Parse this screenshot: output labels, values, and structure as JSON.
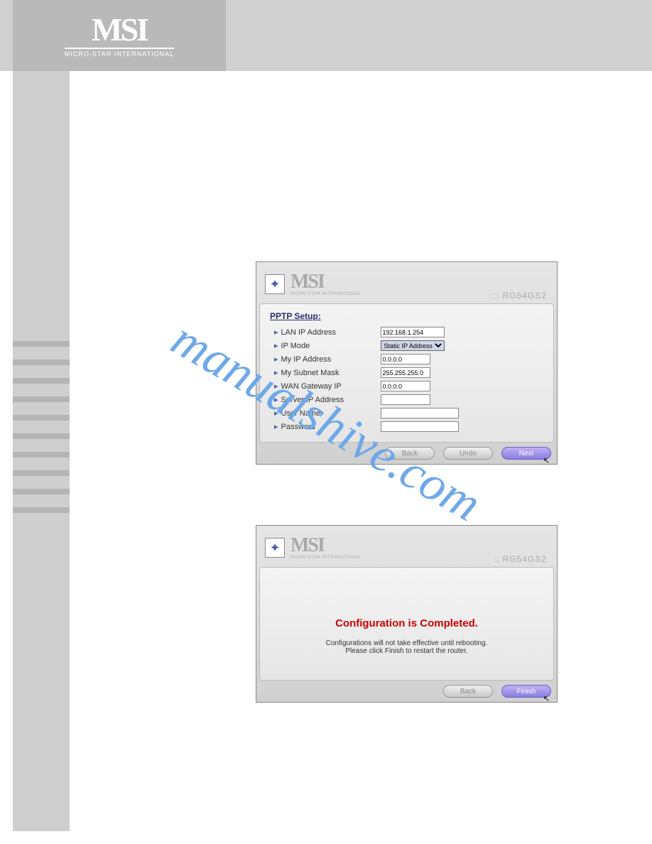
{
  "header": {
    "logo": "MSI",
    "tagline": "MICRO-STAR INTERNATIONAL"
  },
  "watermark": "manualshive.com",
  "panel1": {
    "logo": "MSI",
    "logo_sub": "MICRO-STAR INTERNATIONAL",
    "model": ":: RG54GS2",
    "section_title": "PPTP Setup:",
    "fields": {
      "lan_ip_label": "LAN IP Address",
      "lan_ip_value": "192.168.1.254",
      "ip_mode_label": "IP Mode",
      "ip_mode_value": "Static IP Address",
      "my_ip_label": "My IP Address",
      "my_ip_value": "0.0.0.0",
      "subnet_label": "My Subnet Mask",
      "subnet_value": "255.255.255.0",
      "wan_gw_label": "WAN Gateway IP",
      "wan_gw_value": "0.0.0.0",
      "server_ip_label": "Server IP Address",
      "server_ip_value": "",
      "username_label": "User Name",
      "username_value": "",
      "password_label": "Password",
      "password_value": ""
    },
    "buttons": {
      "back": "Back",
      "undo": "Undo",
      "next": "Next"
    }
  },
  "panel2": {
    "logo": "MSI",
    "logo_sub": "MICRO-STAR INTERNATIONAL",
    "model": ":: RG54GS2",
    "complete_title": "Configuration is Completed.",
    "complete_line1": "Configurations will not take effective until rebooting.",
    "complete_line2": "Please click Finish to restart the router.",
    "buttons": {
      "back": "Back",
      "finish": "Finish"
    }
  }
}
